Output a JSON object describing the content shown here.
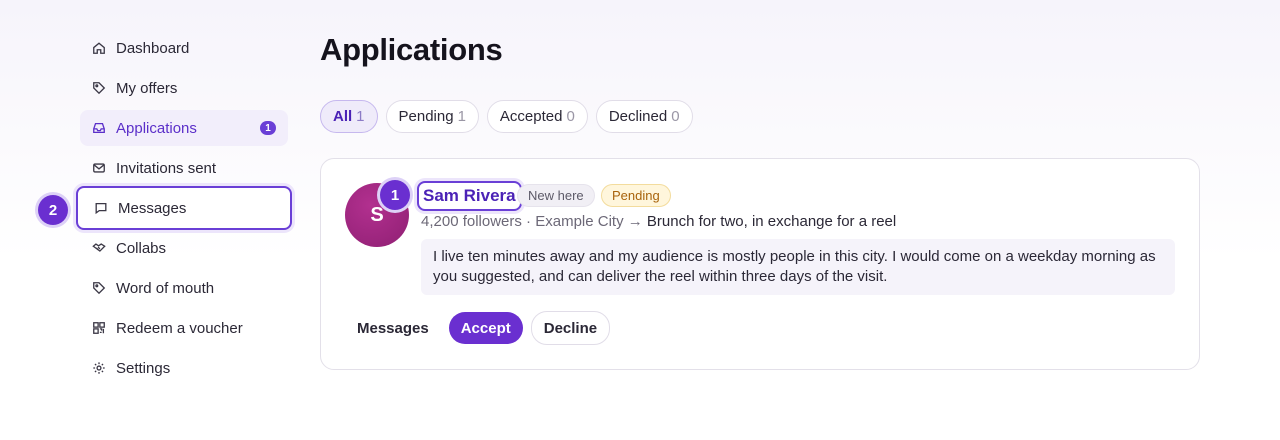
{
  "sidebar": {
    "items": [
      {
        "label": "Dashboard",
        "icon": "home-icon"
      },
      {
        "label": "My offers",
        "icon": "tag-icon"
      },
      {
        "label": "Applications",
        "icon": "inbox-icon",
        "badge": "1"
      },
      {
        "label": "Invitations sent",
        "icon": "mail-icon"
      },
      {
        "label": "Messages",
        "icon": "chat-icon"
      },
      {
        "label": "Collabs",
        "icon": "handshake-icon"
      },
      {
        "label": "Word of mouth",
        "icon": "tag-icon"
      },
      {
        "label": "Redeem a voucher",
        "icon": "qr-code-icon"
      },
      {
        "label": "Settings",
        "icon": "gear-icon"
      }
    ]
  },
  "step_markers": {
    "first": "1",
    "second": "2"
  },
  "main": {
    "title": "Applications",
    "tabs": [
      {
        "label": "All",
        "count": "1"
      },
      {
        "label": "Pending",
        "count": "1"
      },
      {
        "label": "Accepted",
        "count": "0"
      },
      {
        "label": "Declined",
        "count": "0"
      }
    ],
    "application": {
      "avatar_initial": "S",
      "name": "Sam Rivera",
      "new_badge": "New here",
      "status": "Pending",
      "meta": "4,200 followers · Example City →",
      "offer": "Brunch for two, in exchange for a reel",
      "message": "I live ten minutes away and my audience is mostly people in this city. I would come on a weekday morning as you suggested, and can deliver the reel within three days of the visit.",
      "actions": {
        "messages": "Messages",
        "accept": "Accept",
        "decline": "Decline"
      }
    }
  },
  "colors": {
    "accent": "#6a2fd0",
    "avatar": "#a12a84",
    "pending_text": "#a8630c",
    "pending_bg": "#fff6dc"
  }
}
